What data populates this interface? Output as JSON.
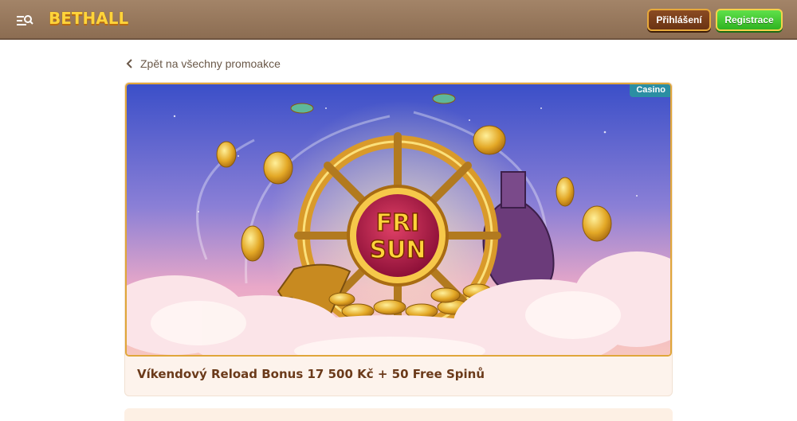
{
  "header": {
    "logo": "BETHALL",
    "menu_icon": "menu-search-icon",
    "login_label": "Přihlášení",
    "register_label": "Registrace"
  },
  "back_link": {
    "label": "Zpět na všechny promoakce",
    "icon": "chevron-left-icon"
  },
  "promo": {
    "category_tag": "Casino",
    "banner_text_top": "FRI",
    "banner_text_bottom": "SUN",
    "title": "Víkendový Reload Bonus 17 500 Kč + 50 Free Spinů"
  },
  "colors": {
    "header_bg": "#9a7b5f",
    "logo": "#ffd43a",
    "login_bg": "#7a3f1b",
    "register_bg": "#3fc62e",
    "tag_bg": "#2b8ea3",
    "title_text": "#6b3a1a",
    "card_bg": "#fdf3ec"
  }
}
